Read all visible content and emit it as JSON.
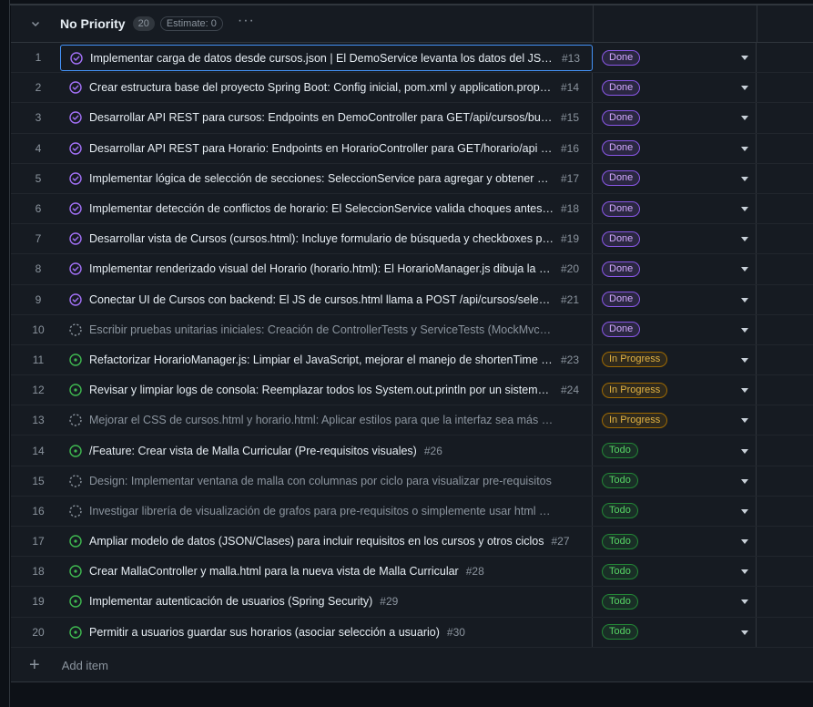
{
  "group": {
    "title": "No Priority",
    "count": "20",
    "estimate": "Estimate: 0",
    "more": "···"
  },
  "status_colors": {
    "Done": "#8957e5",
    "In Progress": "#9e6a03",
    "Todo": "#238636"
  },
  "rows": [
    {
      "n": "1",
      "icon": "done-circle-icon",
      "title": "Implementar carga de datos desde cursos.json | El DemoService levanta los datos del JSON en memoria",
      "issue": "#13",
      "status": "Done"
    },
    {
      "n": "2",
      "icon": "done-circle-icon",
      "title": "Crear estructura base del proyecto Spring Boot: Config inicial, pom.xml y application.properties",
      "issue": "#14",
      "status": "Done"
    },
    {
      "n": "3",
      "icon": "done-circle-icon",
      "title": "Desarrollar API REST para cursos: Endpoints en DemoController para GET/api/cursos/buscar",
      "issue": "#15",
      "status": "Done"
    },
    {
      "n": "4",
      "icon": "done-circle-icon",
      "title": "Desarrollar API REST para Horario: Endpoints en HorarioController para GET/horario/api y más",
      "issue": "#16",
      "status": "Done"
    },
    {
      "n": "5",
      "icon": "done-circle-icon",
      "title": "Implementar lógica de selección de secciones: SeleccionService para agregar y obtener selecciones",
      "issue": "#17",
      "status": "Done"
    },
    {
      "n": "6",
      "icon": "done-circle-icon",
      "title": "Implementar detección de conflictos de horario: El SeleccionService valida choques antes de agregar",
      "issue": "#18",
      "status": "Done"
    },
    {
      "n": "7",
      "icon": "done-circle-icon",
      "title": "Desarrollar vista de Cursos (cursos.html): Incluye formulario de búsqueda y checkboxes para secciones",
      "issue": "#19",
      "status": "Done"
    },
    {
      "n": "8",
      "icon": "done-circle-icon",
      "title": "Implementar renderizado visual del Horario (horario.html): El HorarioManager.js dibuja la parrilla",
      "issue": "#20",
      "status": "Done"
    },
    {
      "n": "9",
      "icon": "done-circle-icon",
      "title": "Conectar UI de Cursos con backend: El JS de cursos.html llama a POST /api/cursos/seleccionar",
      "issue": "#21",
      "status": "Done"
    },
    {
      "n": "10",
      "icon": "draft-circle-icon",
      "title": "Escribir pruebas unitarias iniciales: Creación de ControllerTests y ServiceTests (MockMvc y Mockito)",
      "issue": "",
      "status": "Done"
    },
    {
      "n": "11",
      "icon": "open-circle-icon",
      "title": "Refactorizar HorarioManager.js: Limpiar el JavaScript, mejorar el manejo de shortenTime y otros",
      "issue": "#23",
      "status": "In Progress"
    },
    {
      "n": "12",
      "icon": "open-circle-icon",
      "title": "Revisar y limpiar logs de consola: Reemplazar todos los System.out.println por un sistema de logging",
      "issue": "#24",
      "status": "In Progress"
    },
    {
      "n": "13",
      "icon": "draft-circle-icon",
      "title": "Mejorar el CSS de cursos.html y horario.html: Aplicar estilos para que la interfaz sea más amigable",
      "issue": "",
      "status": "In Progress"
    },
    {
      "n": "14",
      "icon": "open-circle-icon",
      "title": "/Feature: Crear vista de Malla Curricular (Pre-requisitos visuales)",
      "issue": "#26",
      "status": "Todo"
    },
    {
      "n": "15",
      "icon": "draft-circle-icon",
      "title": "Design: Implementar ventana de malla con columnas por ciclo para visualizar pre-requisitos",
      "issue": "",
      "status": "Todo"
    },
    {
      "n": "16",
      "icon": "draft-circle-icon",
      "title": "Investigar librería de visualización de grafos para pre-requisitos o simplemente usar html y css puro",
      "issue": "",
      "status": "Todo"
    },
    {
      "n": "17",
      "icon": "open-circle-icon",
      "title": "Ampliar modelo de datos (JSON/Clases) para incluir requisitos en los cursos y otros ciclos",
      "issue": "#27",
      "status": "Todo"
    },
    {
      "n": "18",
      "icon": "open-circle-icon",
      "title": "Crear MallaController y malla.html para la nueva vista de Malla Curricular",
      "issue": "#28",
      "status": "Todo"
    },
    {
      "n": "19",
      "icon": "open-circle-icon",
      "title": "Implementar autenticación de usuarios (Spring Security)",
      "issue": "#29",
      "status": "Todo"
    },
    {
      "n": "20",
      "icon": "open-circle-icon",
      "title": "Permitir a usuarios guardar sus horarios (asociar selección a usuario)",
      "issue": "#30",
      "status": "Todo"
    }
  ],
  "add_item": {
    "plus": "+",
    "label": "Add item"
  }
}
